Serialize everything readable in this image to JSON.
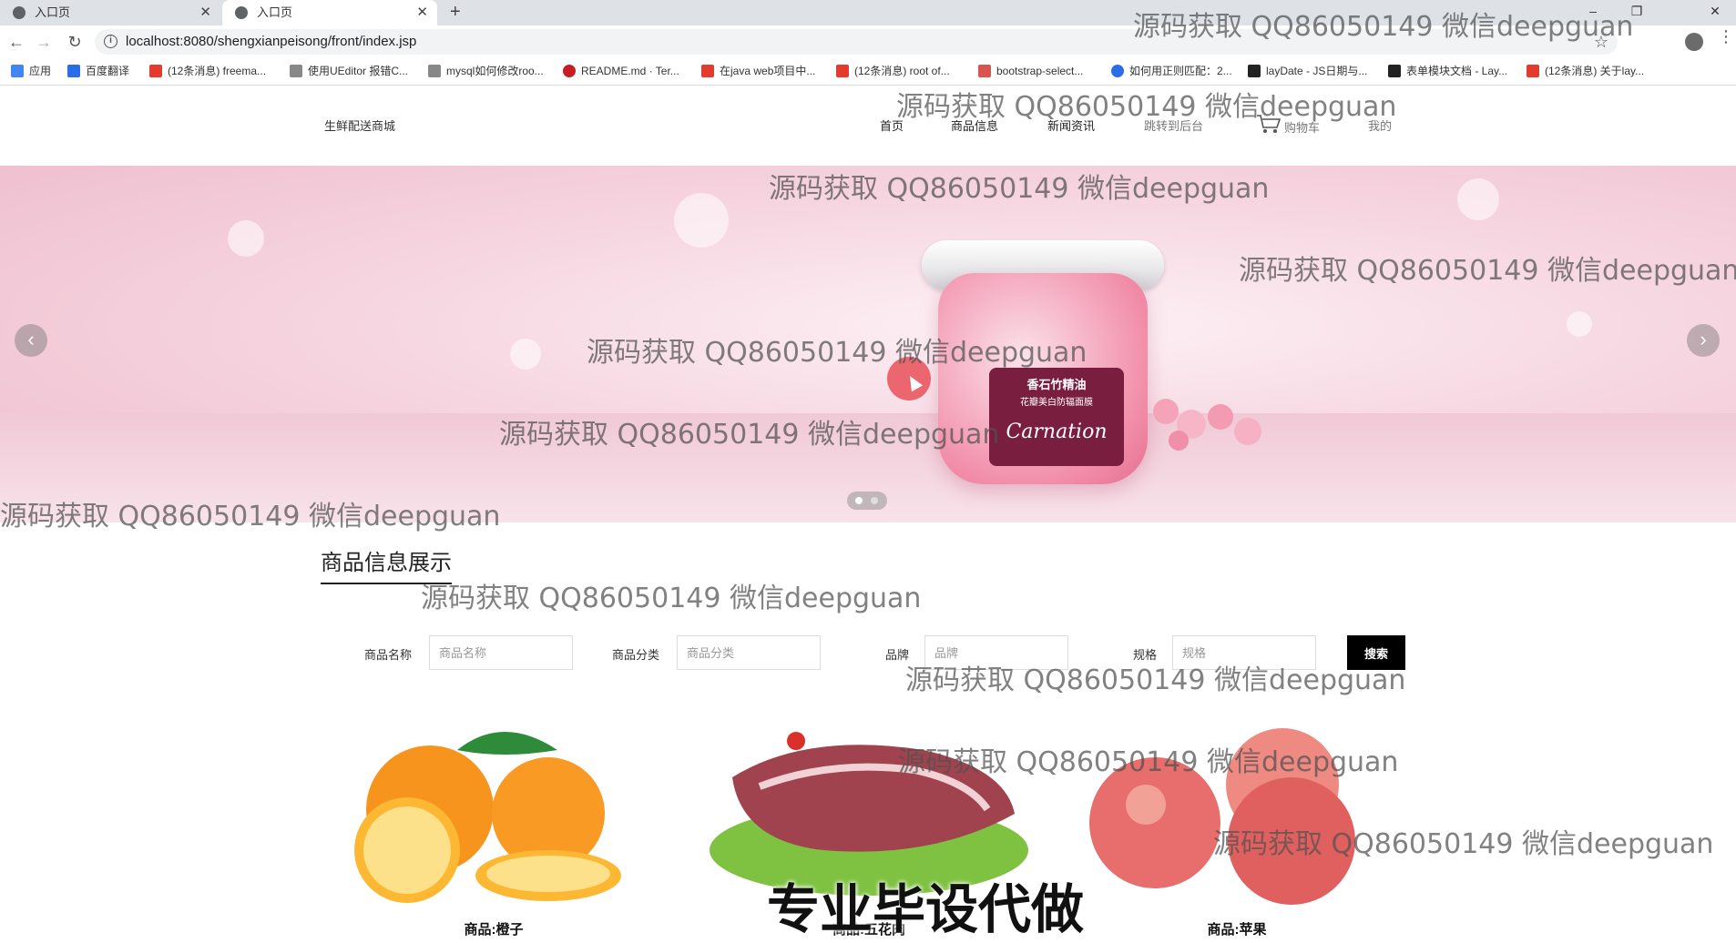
{
  "browser": {
    "tabs": [
      {
        "title": "入口页"
      },
      {
        "title": "入口页"
      }
    ],
    "url": "localhost:8080/shengxianpeisong/front/index.jsp",
    "bookmarks": [
      {
        "label": "应用",
        "color": "#4285f4"
      },
      {
        "label": "百度翻译",
        "color": "#2b6de8"
      },
      {
        "label": "(12条消息) freema...",
        "color": "#e33b2e"
      },
      {
        "label": "使用UEditor 报错C...",
        "color": "#555555"
      },
      {
        "label": "mysql如何修改roo...",
        "color": "#555555"
      },
      {
        "label": "README.md · Ter...",
        "color": "#c71d23"
      },
      {
        "label": "在java web项目中...",
        "color": "#e33b2e"
      },
      {
        "label": "(12条消息) root of...",
        "color": "#e33b2e"
      },
      {
        "label": "bootstrap-select...",
        "color": "#d9534f"
      },
      {
        "label": "如何用正则匹配：2...",
        "color": "#2b6de8"
      },
      {
        "label": "layDate - JS日期与...",
        "color": "#222222"
      },
      {
        "label": "表单模块文档 - Lay...",
        "color": "#222222"
      },
      {
        "label": "(12条消息) 关于lay...",
        "color": "#e33b2e"
      }
    ]
  },
  "site": {
    "brand": "生鲜配送商城",
    "menu": [
      {
        "label": "首页"
      },
      {
        "label": "商品信息"
      },
      {
        "label": "新闻资讯"
      },
      {
        "label": "跳转到后台"
      },
      {
        "label": "购物车"
      },
      {
        "label": "我的"
      }
    ]
  },
  "banner": {
    "product_label_line1": "香石竹精油",
    "product_label_line2": "花瓣美白防辐面膜",
    "product_label_line3": "Carnation",
    "arrow_prev": "‹",
    "arrow_next": "›",
    "slide_count": 2,
    "active_slide": 1
  },
  "products_section": {
    "title": "商品信息展示",
    "filters": [
      {
        "label": "商品名称",
        "placeholder": "商品名称"
      },
      {
        "label": "商品分类",
        "placeholder": "商品分类"
      },
      {
        "label": "品牌",
        "placeholder": "品牌"
      },
      {
        "label": "规格",
        "placeholder": "规格"
      }
    ],
    "search_label": "搜索",
    "items": [
      {
        "name": "商品:橙子"
      },
      {
        "name": "商品:五花肉"
      },
      {
        "name": "商品:苹果"
      }
    ]
  },
  "watermarks": {
    "text": "源码获取 QQ86050149 微信deepguan",
    "big": "专业毕设代做"
  }
}
